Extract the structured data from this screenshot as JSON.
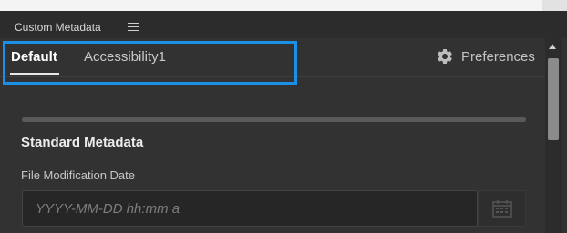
{
  "panel": {
    "title": "Custom Metadata",
    "menu_icon": "hamburger-menu-icon"
  },
  "tabs": [
    {
      "label": "Default",
      "active": true
    },
    {
      "label": "Accessibility1",
      "active": false
    }
  ],
  "preferences": {
    "label": "Preferences",
    "icon": "gear-icon"
  },
  "section": {
    "title": "Standard Metadata"
  },
  "field": {
    "label": "File Modification Date",
    "placeholder": "YYYY-MM-DD hh:mm a",
    "value": "",
    "calendar_icon": "calendar-icon"
  },
  "colors": {
    "highlight": "#1a90e6",
    "background": "#323232",
    "header": "#2c2c2c"
  }
}
